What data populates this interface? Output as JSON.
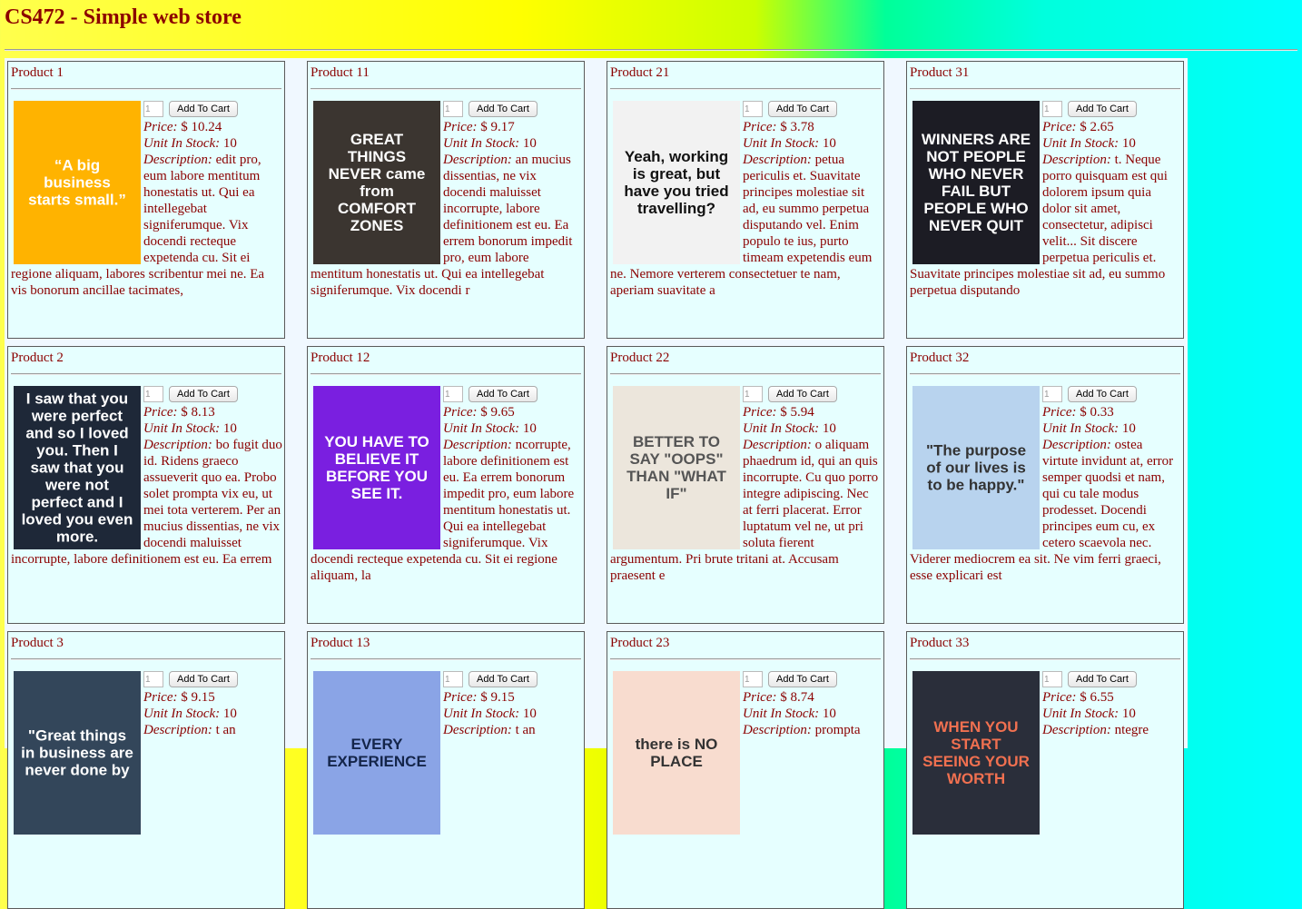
{
  "page": {
    "title": "CS472 - Simple web store"
  },
  "labels": {
    "price": "Price:",
    "stock": "Unit In Stock:",
    "desc": "Description:",
    "add_to_cart": "Add To Cart"
  },
  "products": [
    {
      "name": "Product 1",
      "qty": "1",
      "price": "$ 10.24",
      "stock": "10",
      "desc": "edit pro, eum labore mentitum honestatis ut. Qui ea intellegebat signiferumque. Vix docendi recteque expetenda cu. Sit ei regione aliquam, labores scribentur mei ne. Ea vis bonorum ancillae tacimates,",
      "thumb_text": "“A big business starts small.”",
      "thumb_bg": "#ffb300",
      "thumb_fg": "#ffffff"
    },
    {
      "name": "Product 11",
      "qty": "1",
      "price": "$ 9.17",
      "stock": "10",
      "desc": "an mucius dissentias, ne vix docendi maluisset incorrupte, labore definitionem est eu. Ea errem bonorum impedit pro, eum labore mentitum honestatis ut. Qui ea intellegebat signiferumque. Vix docendi r",
      "thumb_text": "GREAT THINGS NEVER came from COMFORT ZONES",
      "thumb_bg": "#3b3530",
      "thumb_fg": "#ffffff"
    },
    {
      "name": "Product 21",
      "qty": "1",
      "price": "$ 3.78",
      "stock": "10",
      "desc": "petua periculis et. Suavitate principes molestiae sit ad, eu summo perpetua disputando vel. Enim populo te ius, purto timeam expetendis eum ne. Nemore verterem consectetuer te nam, aperiam suavitate a",
      "thumb_text": "Yeah, working is great, but have you tried travelling?",
      "thumb_bg": "#f2f2f2",
      "thumb_fg": "#111111"
    },
    {
      "name": "Product 31",
      "qty": "1",
      "price": "$ 2.65",
      "stock": "10",
      "desc": "t. Neque porro quisquam est qui dolorem ipsum quia dolor sit amet, consectetur, adipisci velit... Sit discere perpetua periculis et. Suavitate principes molestiae sit ad, eu summo perpetua disputando",
      "thumb_text": "WINNERS ARE NOT PEOPLE WHO NEVER FAIL BUT PEOPLE WHO NEVER QUIT",
      "thumb_bg": "#1c1c24",
      "thumb_fg": "#ffffff"
    },
    {
      "name": "Product 2",
      "qty": "1",
      "price": "$ 8.13",
      "stock": "10",
      "desc": "bo fugit duo id. Ridens graeco assueverit quo ea. Probo solet prompta vix eu, ut mei tota verterem. Per an mucius dissentias, ne vix docendi maluisset incorrupte, labore definitionem est eu. Ea errem",
      "thumb_text": "I saw that you were perfect and so I loved you. Then I saw that you were not perfect and I loved you even more.",
      "thumb_bg": "#1e2838",
      "thumb_fg": "#ffffff"
    },
    {
      "name": "Product 12",
      "qty": "1",
      "price": "$ 9.65",
      "stock": "10",
      "desc": "ncorrupte, labore definitionem est eu. Ea errem bonorum impedit pro, eum labore mentitum honestatis ut. Qui ea intellegebat signiferumque. Vix docendi recteque expetenda cu. Sit ei regione aliquam, la",
      "thumb_text": "YOU HAVE TO BELIEVE IT BEFORE YOU SEE IT.",
      "thumb_bg": "#7a1fe0",
      "thumb_fg": "#ffffff"
    },
    {
      "name": "Product 22",
      "qty": "1",
      "price": "$ 5.94",
      "stock": "10",
      "desc": "o aliquam phaedrum id, qui an quis incorrupte. Cu quo porro integre adipiscing. Nec at ferri placerat. Error luptatum vel ne, ut pri soluta fierent argumentum. Pri brute tritani at. Accusam praesent e",
      "thumb_text": "BETTER TO SAY \"OOPS\" THAN \"WHAT IF\"",
      "thumb_bg": "#ece6dc",
      "thumb_fg": "#555555"
    },
    {
      "name": "Product 32",
      "qty": "1",
      "price": "$ 0.33",
      "stock": "10",
      "desc": "ostea virtute invidunt at, error semper quodsi et nam, qui cu tale modus prodesset. Docendi principes eum cu, ex cetero scaevola nec. Viderer mediocrem ea sit. Ne vim ferri graeci, esse explicari est",
      "thumb_text": "\"The purpose of our lives is to be happy.\"",
      "thumb_bg": "#b8d3ee",
      "thumb_fg": "#333333"
    },
    {
      "name": "Product 3",
      "qty": "1",
      "price": "$ 9.15",
      "stock": "10",
      "desc": "t an",
      "thumb_text": "\"Great things in business are never done by",
      "thumb_bg": "#33465a",
      "thumb_fg": "#ffffff"
    },
    {
      "name": "Product 13",
      "qty": "1",
      "price": "$ 9.15",
      "stock": "10",
      "desc": "t an",
      "thumb_text": "EVERY EXPERIENCE",
      "thumb_bg": "#8aa4e6",
      "thumb_fg": "#14254a"
    },
    {
      "name": "Product 23",
      "qty": "1",
      "price": "$ 8.74",
      "stock": "10",
      "desc": "prompta",
      "thumb_text": "there is NO PLACE",
      "thumb_bg": "#f8dccf",
      "thumb_fg": "#333333"
    },
    {
      "name": "Product 33",
      "qty": "1",
      "price": "$ 6.55",
      "stock": "10",
      "desc": "ntegre",
      "thumb_text": "WHEN YOU START SEEING YOUR WORTH",
      "thumb_bg": "#2a2e3a",
      "thumb_fg": "#f07050"
    }
  ]
}
